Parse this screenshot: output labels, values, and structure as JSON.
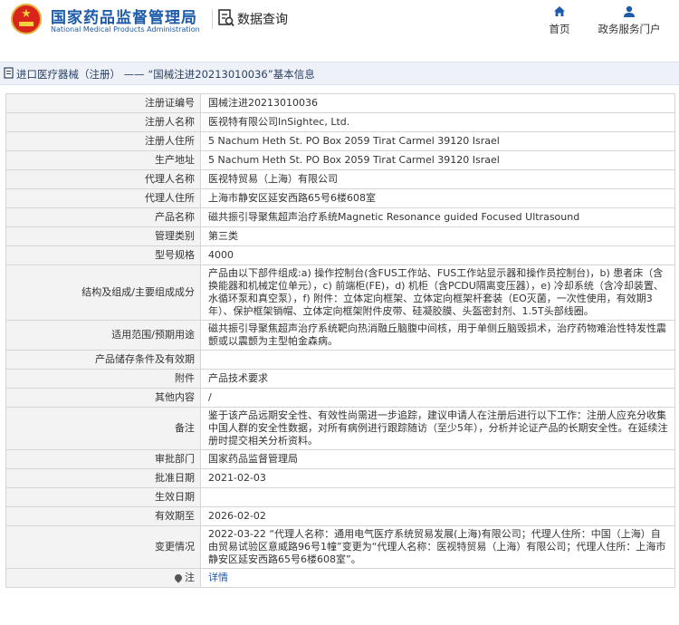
{
  "header": {
    "logo_cn": "国家药品监督管理局",
    "logo_en": "National Medical Products Administration",
    "section_title": "数据查询",
    "nav": [
      {
        "label": "首页",
        "icon": "home-icon"
      },
      {
        "label": "政务服务门户",
        "icon": "user-icon"
      }
    ]
  },
  "breadcrumb": {
    "category": "进口医疗器械（注册）",
    "separator": "——",
    "title": "“国械注进20213010036”基本信息"
  },
  "record": [
    {
      "label": "注册证编号",
      "value": "国械注进20213010036"
    },
    {
      "label": "注册人名称",
      "value": "医视特有限公司InSightec, Ltd."
    },
    {
      "label": "注册人住所",
      "value": "5 Nachum Heth St. PO Box 2059 Tirat Carmel 39120 Israel"
    },
    {
      "label": "生产地址",
      "value": "5 Nachum Heth St. PO Box 2059 Tirat Carmel 39120 Israel"
    },
    {
      "label": "代理人名称",
      "value": "医视特贸易（上海）有限公司"
    },
    {
      "label": "代理人住所",
      "value": "上海市静安区延安西路65号6楼608室"
    },
    {
      "label": "产品名称",
      "value": "磁共振引导聚焦超声治疗系统Magnetic Resonance guided Focused Ultrasound"
    },
    {
      "label": "管理类别",
      "value": "第三类"
    },
    {
      "label": "型号规格",
      "value": "4000"
    },
    {
      "label": "结构及组成/主要组成成分",
      "value": "产品由以下部件组成:a) 操作控制台(含FUS工作站、FUS工作站显示器和操作员控制台)，b) 患者床（含换能器和机械定位单元），c) 前端柜(FE)，d) 机柜（含PCDU隔离变压器），e) 冷却系统（含冷却装置、水循环泵和真空泵），f) 附件：立体定向框架、立体定向框架杆套装（EO灭菌，一次性使用，有效期3年）、保护框架销帽、立体定向框架附件皮带、硅凝胶膜、头盔密封剂、1.5T头部线圈。"
    },
    {
      "label": "适用范围/预期用途",
      "value": "磁共振引导聚焦超声治疗系统靶向热消融丘脑腹中间核，用于单侧丘脑毁损术，治疗药物难治性特发性震颤或以震颤为主型帕金森病。"
    },
    {
      "label": "产品储存条件及有效期",
      "value": ""
    },
    {
      "label": "附件",
      "value": "产品技术要求"
    },
    {
      "label": "其他内容",
      "value": "/"
    },
    {
      "label": "备注",
      "value": "鉴于该产品远期安全性、有效性尚需进一步追踪，建议申请人在注册后进行以下工作：注册人应充分收集中国人群的安全性数据，对所有病例进行跟踪随访（至少5年），分析并论证产品的长期安全性。在延续注册时提交相关分析资料。"
    },
    {
      "label": "审批部门",
      "value": "国家药品监督管理局"
    },
    {
      "label": "批准日期",
      "value": "2021-02-03"
    },
    {
      "label": "生效日期",
      "value": ""
    },
    {
      "label": "有效期至",
      "value": "2026-02-02"
    },
    {
      "label": "变更情况",
      "value": "2022-03-22 “代理人名称：通用电气医疗系统贸易发展(上海)有限公司；代理人住所：中国（上海）自由贸易试验区意威路96号1幢”变更为“代理人名称：医视特贸易（上海）有限公司；代理人住所：上海市静安区延安西路65号6楼608室”。"
    }
  ],
  "note": {
    "label": "注",
    "link": "详情",
    "icon": "pin-icon"
  }
}
